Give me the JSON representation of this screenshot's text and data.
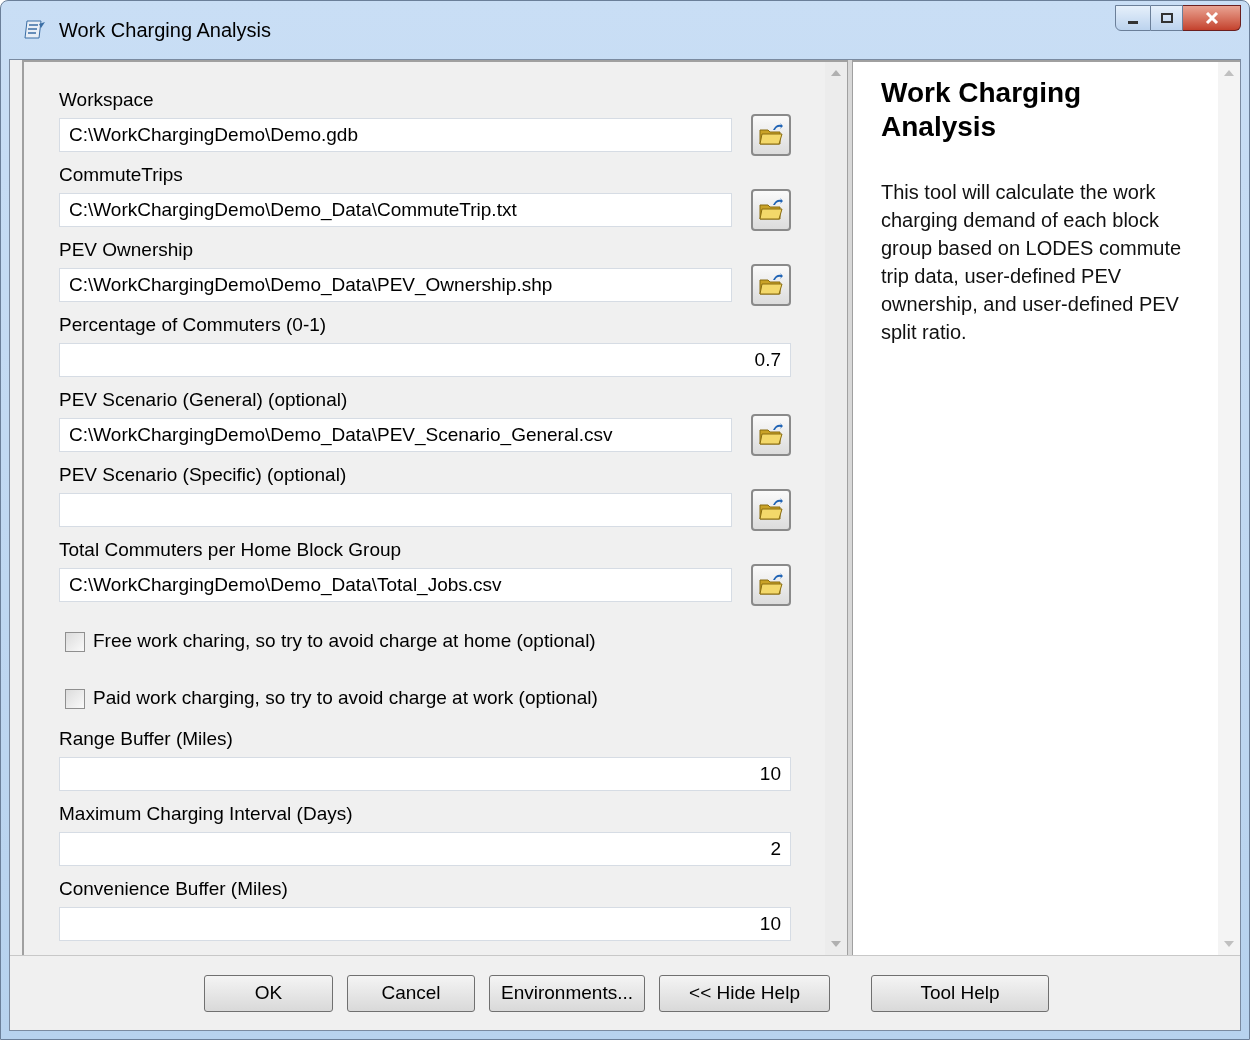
{
  "window": {
    "title": "Work Charging Analysis"
  },
  "parameters": [
    {
      "kind": "path",
      "label": "Workspace",
      "value": "C:\\WorkChargingDemo\\Demo.gdb"
    },
    {
      "kind": "path",
      "label": "CommuteTrips",
      "value": "C:\\WorkChargingDemo\\Demo_Data\\CommuteTrip.txt"
    },
    {
      "kind": "path",
      "label": "PEV Ownership",
      "value": "C:\\WorkChargingDemo\\Demo_Data\\PEV_Ownership.shp"
    },
    {
      "kind": "number",
      "label": "Percentage of Commuters (0-1)",
      "value": "0.7"
    },
    {
      "kind": "path",
      "label": "PEV Scenario (General) (optional)",
      "value": "C:\\WorkChargingDemo\\Demo_Data\\PEV_Scenario_General.csv"
    },
    {
      "kind": "path",
      "label": "PEV Scenario (Specific) (optional)"
    },
    {
      "kind": "path",
      "label": "Total Commuters per Home Block Group",
      "value": "C:\\WorkChargingDemo\\Demo_Data\\Total_Jobs.csv"
    },
    {
      "kind": "checkbox",
      "label": "Free work charing, so try to avoid charge at home (optional)",
      "checked": false
    },
    {
      "kind": "checkbox",
      "label": "Paid work charging, so try to avoid charge at work (optional)",
      "checked": false
    },
    {
      "kind": "number",
      "label": "Range Buffer (Miles)",
      "value": "10"
    },
    {
      "kind": "number",
      "label": "Maximum Charging Interval (Days)",
      "value": "2"
    },
    {
      "kind": "number",
      "label": "Convenience Buffer (Miles)",
      "value": "10"
    }
  ],
  "help": {
    "title": "Work Charging Analysis",
    "text": "This tool will calculate the work charging demand of each block group based on LODES commute trip data, user-defined PEV ownership, and user-defined PEV split ratio."
  },
  "buttons": [
    "OK",
    "Cancel",
    "Environments...",
    "<< Hide Help",
    "Tool Help"
  ]
}
